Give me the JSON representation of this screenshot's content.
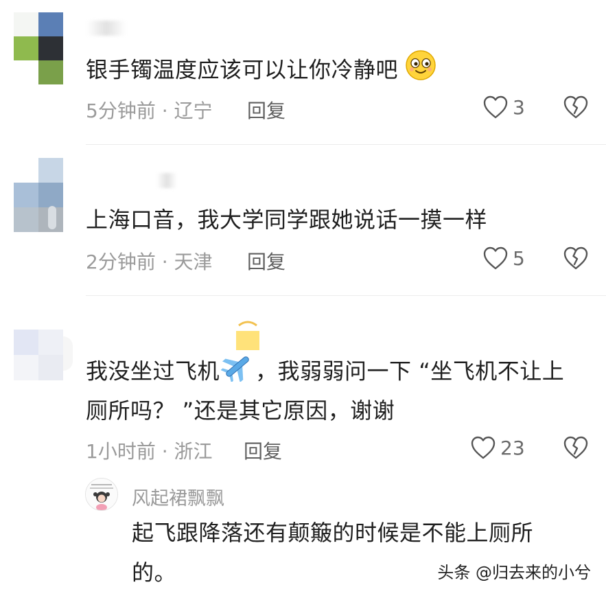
{
  "comments": [
    {
      "text": "银手镯温度应该可以让你冷静吧",
      "time": "5分钟前",
      "location": "辽宁",
      "meta": "5分钟前 · 辽宁",
      "reply_label": "回复",
      "likes": "3",
      "emoji": "smiling-face-emoji"
    },
    {
      "text": "上海口音，我大学同学跟她说话一摸一样",
      "time": "2分钟前",
      "location": "天津",
      "meta": "2分钟前 · 天津",
      "reply_label": "回复",
      "likes": "5"
    },
    {
      "text_line1": "我没坐过飞机",
      "text_line1_after": "，我弱弱问一下 “坐飞机不让上",
      "text_line2": "厕所吗？ ”还是其它原因，谢谢",
      "time": "1小时前",
      "location": "浙江",
      "meta": "1小时前 · 浙江",
      "reply_label": "回复",
      "likes": "23",
      "emoji": "airplane-emoji",
      "reply": {
        "username": "风起裙飘飘",
        "text_line1": "起飞跟降落还有颠簸的时候是不能上厕所",
        "text_line2": "的。"
      }
    }
  ],
  "watermark": "头条 @归去来的小兮",
  "icons": {
    "like": "heart-outline-icon",
    "dislike": "broken-heart-icon"
  },
  "colors": {
    "text": "#1f1f1f",
    "meta": "#9a9a9a",
    "reply": "#5f5f5f",
    "icon": "#555555"
  }
}
